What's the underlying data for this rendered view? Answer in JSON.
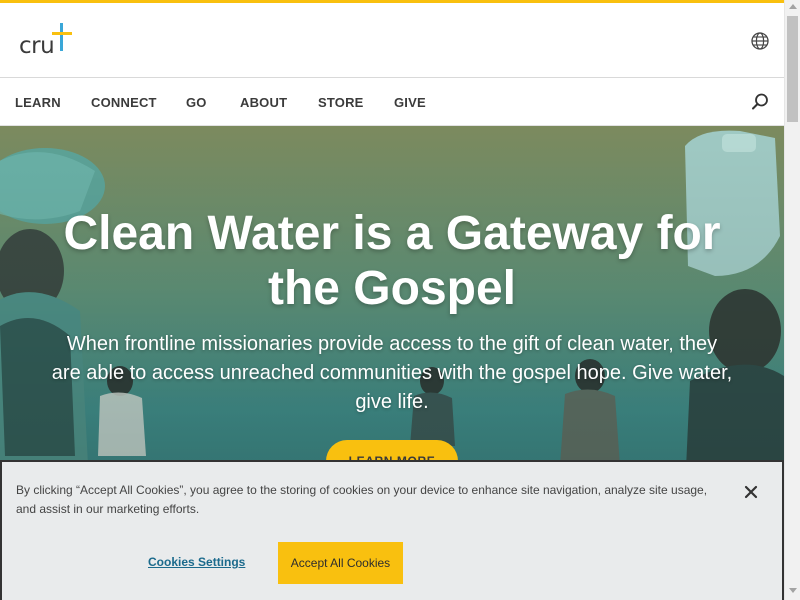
{
  "brand": {
    "logo_text": "cru",
    "accent_color": "#f9c00f",
    "cross_colors": [
      "#3aa7d8",
      "#f9c00f"
    ]
  },
  "header": {
    "globe_icon": "globe-icon"
  },
  "nav": {
    "items": [
      {
        "label": "LEARN"
      },
      {
        "label": "CONNECT"
      },
      {
        "label": "GO"
      },
      {
        "label": "ABOUT"
      },
      {
        "label": "STORE"
      },
      {
        "label": "GIVE"
      }
    ],
    "search_icon": "search-icon"
  },
  "hero": {
    "title": "Clean Water is a Gateway for the Gospel",
    "subtitle": "When frontline missionaries provide access to the gift of clean water, they are able to access unreached communities with the gospel hope. Give water, give life.",
    "cta_label": "LEARN MORE"
  },
  "cookie_banner": {
    "text": "By clicking “Accept All Cookies”, you agree to the storing of cookies on your device to enhance site navigation, analyze site usage, and assist in our marketing efforts.",
    "settings_label": "Cookies Settings",
    "accept_label": "Accept All Cookies",
    "close_icon": "close-icon"
  }
}
